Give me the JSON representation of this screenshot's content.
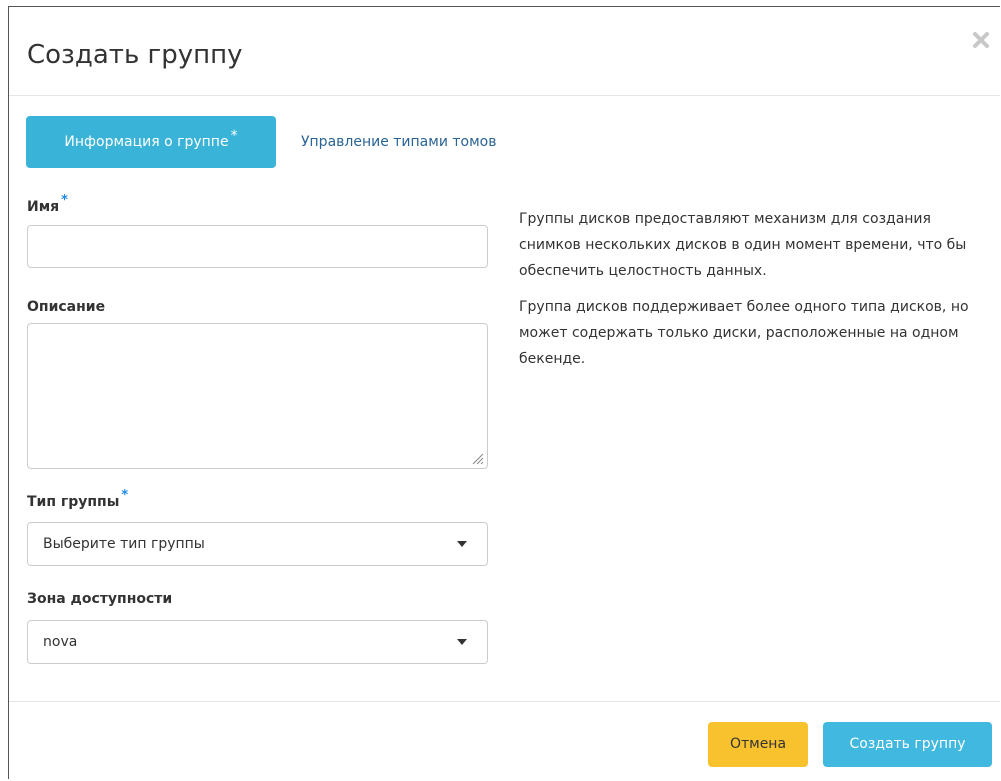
{
  "modal": {
    "title": "Создать группу",
    "close_icon": "close-icon"
  },
  "tabs": [
    {
      "label": "Информация о группе",
      "required_mark": "*",
      "active": true
    },
    {
      "label": "Управление типами томов",
      "active": false
    }
  ],
  "form": {
    "name": {
      "label": "Имя",
      "required_mark": "*",
      "value": ""
    },
    "description": {
      "label": "Описание",
      "value": ""
    },
    "group_type": {
      "label": "Тип группы",
      "required_mark": "*",
      "selected": "Выберите тип группы"
    },
    "availability_zone": {
      "label": "Зона доступности",
      "selected": "nova"
    }
  },
  "help": {
    "paragraph1": "Группы дисков предоставляют механизм для создания снимков нескольких дисков в один момент времени, что бы обеспечить целостность данных.",
    "paragraph2": "Группа дисков поддерживает более одного типа дисков, но может содержать только диски, расположенные на одном бекенде."
  },
  "footer": {
    "cancel_label": "Отмена",
    "submit_label": "Создать группу"
  },
  "colors": {
    "accent": "#39b3d7",
    "cancel": "#f8c12e",
    "link": "#2a6496",
    "required": "#1e88e5"
  }
}
